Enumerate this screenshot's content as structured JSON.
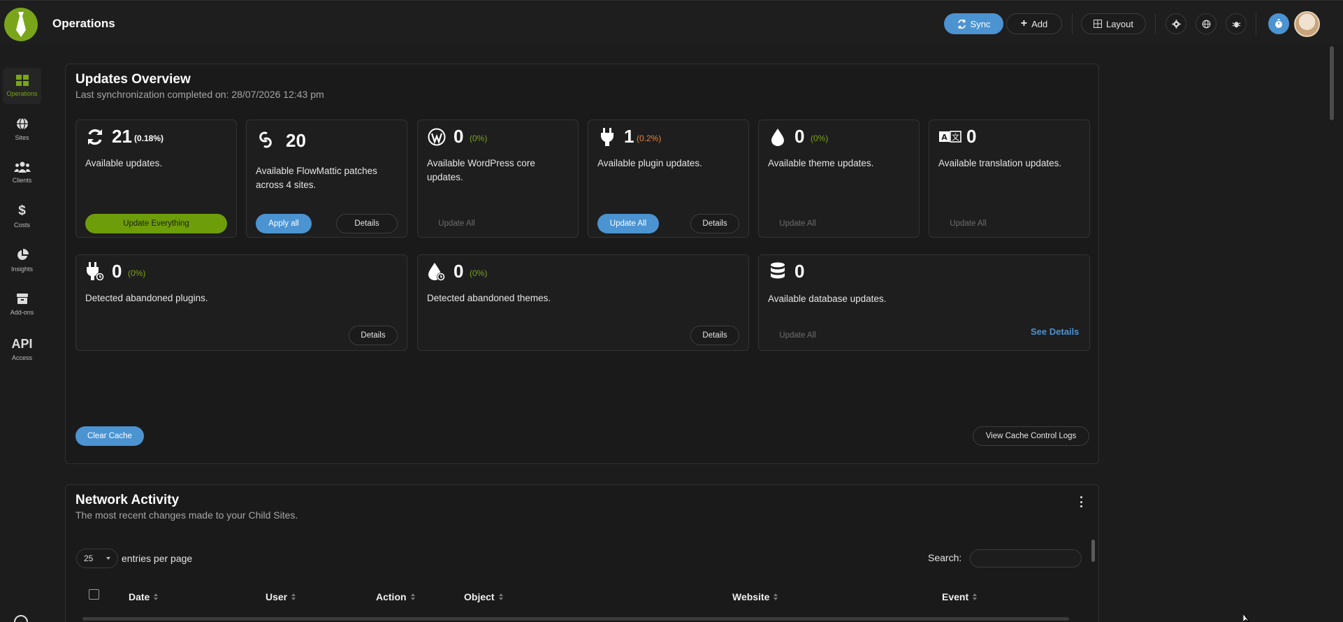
{
  "header": {
    "title": "Operations",
    "sync_label": "Sync",
    "add_label": "Add",
    "layout_label": "Layout"
  },
  "sidebar": {
    "items": [
      {
        "label": "Operations",
        "icon": "grid-icon"
      },
      {
        "label": "Sites",
        "icon": "globe-icon"
      },
      {
        "label": "Clients",
        "icon": "users-icon"
      },
      {
        "label": "Costs",
        "icon": "dollar-icon"
      },
      {
        "label": "Insights",
        "icon": "pie-chart-icon"
      },
      {
        "label": "Add-ons",
        "icon": "box-icon"
      },
      {
        "label": "Access",
        "icon": "api-icon",
        "title": "API"
      }
    ]
  },
  "updates": {
    "title": "Updates Overview",
    "subtitle": "Last synchronization completed on: 28/07/2026 12:43 pm",
    "cards": [
      {
        "count": "21",
        "pct": "(0.18%)",
        "desc": "Available updates.",
        "primary": "Update Everything"
      },
      {
        "count": "20",
        "desc": "Available FlowMattic patches across 4 sites.",
        "primary": "Apply all",
        "secondary": "Details"
      },
      {
        "count": "0",
        "pct": "(0%)",
        "desc": "Available WordPress core updates.",
        "primary": "Update All"
      },
      {
        "count": "1",
        "pct": "(0.2%)",
        "desc": "Available plugin updates.",
        "primary": "Update All",
        "secondary": "Details"
      },
      {
        "count": "0",
        "pct": "(0%)",
        "desc": "Available theme updates.",
        "primary": "Update All"
      },
      {
        "count": "0",
        "desc": "Available translation updates.",
        "primary": "Update All"
      },
      {
        "count": "0",
        "pct": "(0%)",
        "desc": "Detected abandoned plugins.",
        "secondary": "Details"
      },
      {
        "count": "0",
        "pct": "(0%)",
        "desc": "Detected abandoned themes.",
        "secondary": "Details"
      },
      {
        "count": "0",
        "desc": "Available database updates.",
        "primary": "Update All",
        "link": "See Details"
      }
    ],
    "clear_cache_label": "Clear Cache",
    "view_logs_label": "View Cache Control Logs"
  },
  "network": {
    "title": "Network Activity",
    "subtitle": "The most recent changes made to your Child Sites.",
    "entries_value": "25",
    "entries_label": "entries per page",
    "search_label": "Search:",
    "columns": [
      "Date",
      "User",
      "Action",
      "Object",
      "Website",
      "Event"
    ]
  },
  "colors": {
    "accent_green": "#7aa51a",
    "accent_blue": "#4b93d1",
    "warning_orange": "#e8823a"
  }
}
